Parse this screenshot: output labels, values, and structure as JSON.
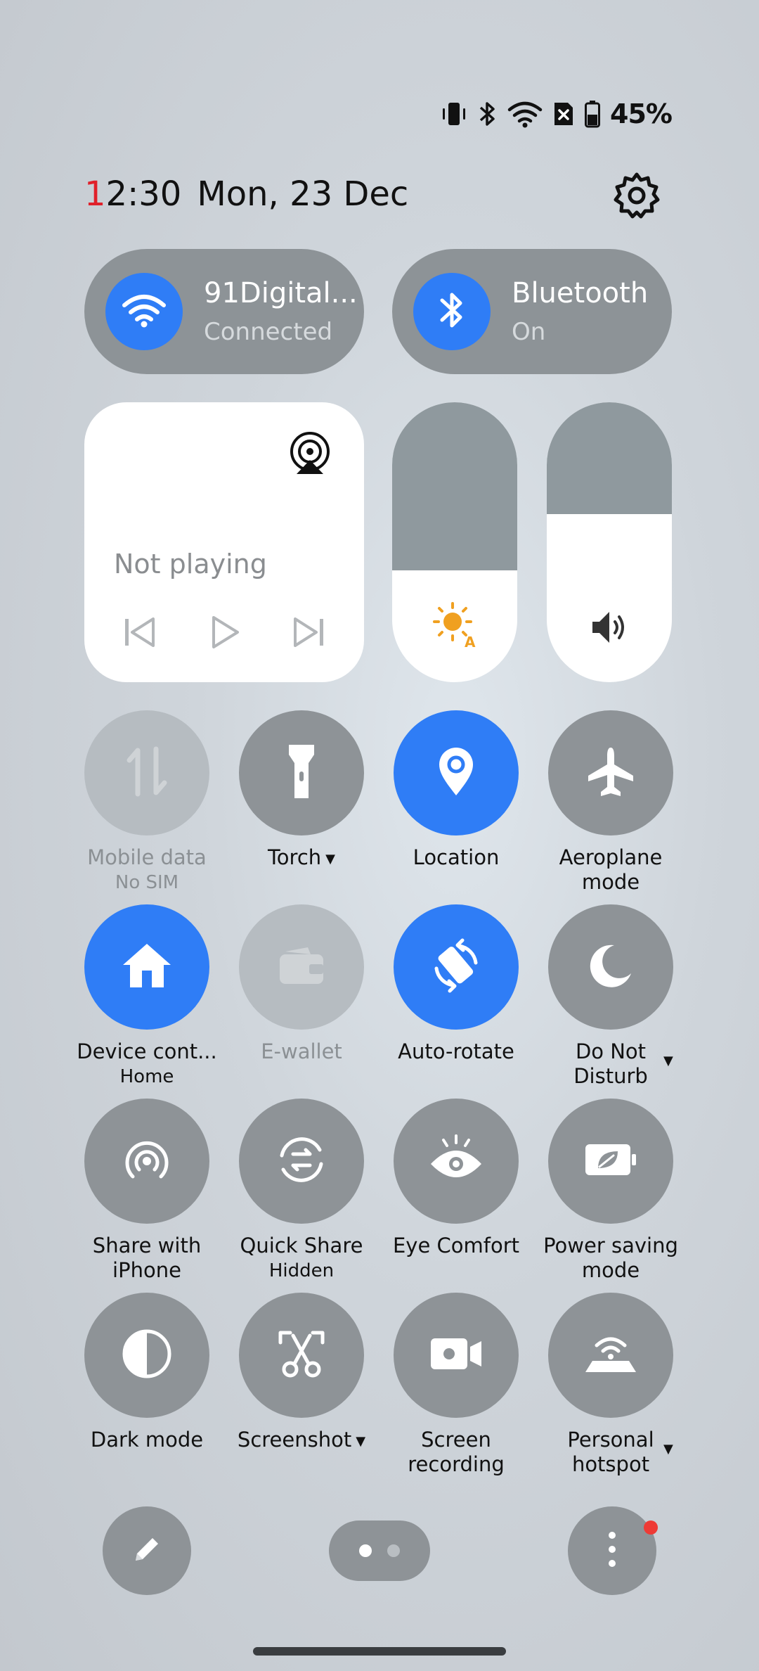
{
  "colors": {
    "accent": "#2f7df6",
    "tile_off": "#8e9397",
    "clock_red": "#e0202a",
    "notification": "#ee3a35",
    "sun_icon": "#f0a020"
  },
  "status_bar": {
    "battery_percent": "45%",
    "icons": [
      "vibrate-icon",
      "bluetooth-icon",
      "wifi-icon",
      "no-sim-icon",
      "battery-icon"
    ]
  },
  "header": {
    "time_first_digit": "1",
    "time_rest": "2:30",
    "date": "Mon, 23 Dec"
  },
  "wifi_tile": {
    "title": "91Digital...",
    "subtitle": "Connected"
  },
  "bluetooth_tile": {
    "title": "Bluetooth",
    "subtitle": "On"
  },
  "media": {
    "status": "Not playing"
  },
  "brightness": {
    "level_percent": 40
  },
  "volume": {
    "level_percent": 60
  },
  "tiles": {
    "mobile_data": {
      "label": "Mobile data",
      "sub": "No SIM"
    },
    "torch": {
      "label": "Torch"
    },
    "location": {
      "label": "Location"
    },
    "aeroplane": {
      "line1": "Aeroplane",
      "line2": "mode"
    },
    "device_controls": {
      "label": "Device cont...",
      "sub": "Home"
    },
    "ewallet": {
      "label": "E-wallet"
    },
    "autorotate": {
      "label": "Auto-rotate"
    },
    "dnd": {
      "line1": "Do Not",
      "line2": "Disturb"
    },
    "share_iphone": {
      "line1": "Share with",
      "line2": "iPhone"
    },
    "quick_share": {
      "label": "Quick Share",
      "sub": "Hidden"
    },
    "eye_comfort": {
      "label": "Eye Comfort"
    },
    "power_saving": {
      "line1": "Power saving",
      "line2": "mode"
    },
    "dark_mode": {
      "label": "Dark mode"
    },
    "screenshot": {
      "label": "Screenshot"
    },
    "screen_recording": {
      "line1": "Screen",
      "line2": "recording"
    },
    "hotspot": {
      "line1": "Personal",
      "line2": "hotspot"
    }
  },
  "pager": {
    "pages": 2,
    "current": 1
  }
}
